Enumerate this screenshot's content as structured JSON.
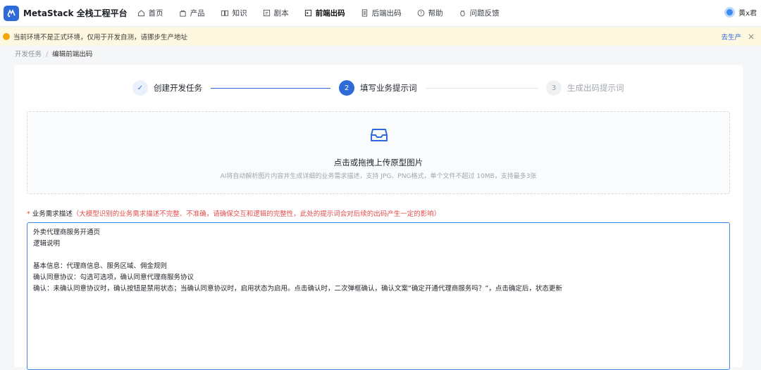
{
  "app": {
    "title": "MetaStack 全栈工程平台"
  },
  "nav": [
    {
      "label": "首页",
      "icon": "home-icon"
    },
    {
      "label": "产品",
      "icon": "bag-icon"
    },
    {
      "label": "知识",
      "icon": "book-icon"
    },
    {
      "label": "剧本",
      "icon": "script-icon"
    },
    {
      "label": "前端出码",
      "icon": "frontend-code-icon",
      "active": true
    },
    {
      "label": "后端出码",
      "icon": "backend-code-icon"
    },
    {
      "label": "帮助",
      "icon": "help-icon"
    },
    {
      "label": "问题反馈",
      "icon": "bug-icon"
    }
  ],
  "user": {
    "name": "黄x君"
  },
  "banner": {
    "text": "当前环境不是正式环境，仅用于开发自测，请挪步生产地址",
    "link": "去生产"
  },
  "breadcrumb": {
    "parent": "开发任务",
    "current": "编辑前端出码"
  },
  "steps": [
    {
      "index": "✓",
      "label": "创建开发任务",
      "status": "done"
    },
    {
      "index": "2",
      "label": "填写业务提示词",
      "status": "active"
    },
    {
      "index": "3",
      "label": "生成出码提示词",
      "status": "pending"
    }
  ],
  "upload": {
    "title": "点击或拖拽上传原型图片",
    "hint": "AI将自动解析图片内容并生成详细的业务需求描述，支持 JPG、PNG格式，单个文件不超过 10MB，支持最多3张"
  },
  "description": {
    "label": "业务需求描述",
    "note": "（大模型识别的业务需求描述不完整、不准确，请确保交互和逻辑的完整性，此处的提示词会对后续的出码产生一定的影响）",
    "value": "外卖代理商服务开通页\n逻辑说明\n\n基本信息：代理商信息、服务区域、佣金规则\n确认同意协议：勾选可选项，确认同意代理商服务协议\n确认：未确认同意协议时，确认按钮是禁用状态；当确认同意协议时，启用状态为启用。点击确认时，二次弹框确认，确认文案“确定开通代理商服务吗？”，点击确定后，状态更新"
  },
  "colors": {
    "primary": "#2f6bd8",
    "warning": "#f2a60c",
    "danger": "#e34d4d"
  }
}
